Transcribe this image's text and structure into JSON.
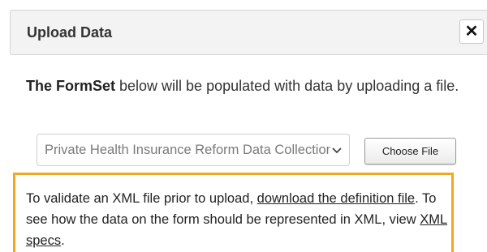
{
  "dialog": {
    "title": "Upload Data",
    "close_symbol": "✕"
  },
  "intro": {
    "bold_text": "The FormSet",
    "rest_text": " below will be populated with data by uploading a file."
  },
  "form_select": {
    "selected_value": "Private Health Insurance Reform Data Collection",
    "chevron_icon": "chevron-down-icon"
  },
  "choose_file": {
    "label": "Choose File"
  },
  "info": {
    "text_1": "To validate an XML file prior to upload, ",
    "link_1": "download the definition file",
    "text_2": ". To see how the data on the form should be represented in XML, view ",
    "link_2": "XML specs",
    "text_3": "."
  },
  "colors": {
    "accent_border": "#f0a81c",
    "titlebar_bg": "#f3f3f3"
  }
}
